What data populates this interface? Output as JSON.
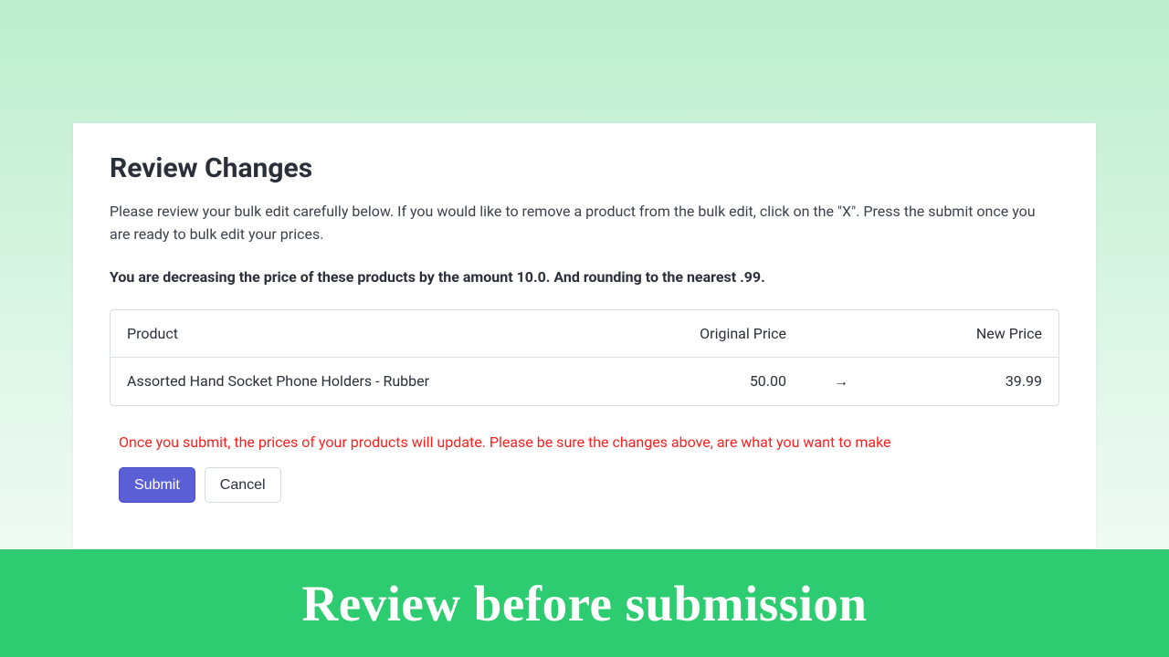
{
  "title": "Review Changes",
  "intro": "Please review your bulk edit carefully below. If you would like to remove a product from the bulk edit, click on the \"X\". Press the submit once you are ready to bulk edit your prices.",
  "summary": "You are decreasing the price of these products by the amount 10.0. And rounding to the nearest .99.",
  "table": {
    "headers": {
      "product": "Product",
      "original": "Original Price",
      "new": "New Price"
    },
    "rows": [
      {
        "product": "Assorted Hand Socket Phone Holders - Rubber",
        "original": "50.00",
        "arrow": "→",
        "new": "39.99"
      }
    ]
  },
  "warning": "Once you submit, the prices of your products will update. Please be sure the changes above, are what you want to make",
  "buttons": {
    "submit": "Submit",
    "cancel": "Cancel"
  },
  "banner": "Review before submission"
}
